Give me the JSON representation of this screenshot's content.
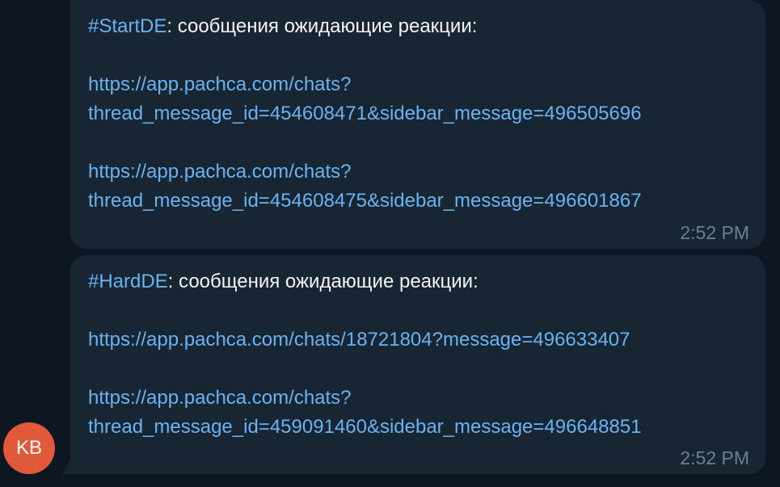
{
  "messages": [
    {
      "tag": "#StartDE",
      "text": ": сообщения ожидающие реакции:",
      "links": [
        {
          "line1": "https://app.pachca.com/chats?",
          "line2": "thread_message_id=454608471&sidebar_message=496505696"
        },
        {
          "line1": "https://app.pachca.com/chats?",
          "line2": "thread_message_id=454608475&sidebar_message=496601867"
        }
      ],
      "time": "2:52 PM"
    },
    {
      "tag": "#HardDE",
      "text": ": сообщения ожидающие реакции:",
      "link_single": "https://app.pachca.com/chats/18721804?message=496633407",
      "links": [
        {
          "line1": "https://app.pachca.com/chats?",
          "line2": "thread_message_id=459091460&sidebar_message=496648851"
        }
      ],
      "time": "2:52 PM"
    }
  ],
  "avatar": {
    "initials": "KB",
    "color": "#e05a3a"
  },
  "colors": {
    "background": "#0e1621",
    "bubble": "#182533",
    "link": "#6ab3f3",
    "text": "#f5f5f5",
    "time": "#6d7f8f"
  }
}
